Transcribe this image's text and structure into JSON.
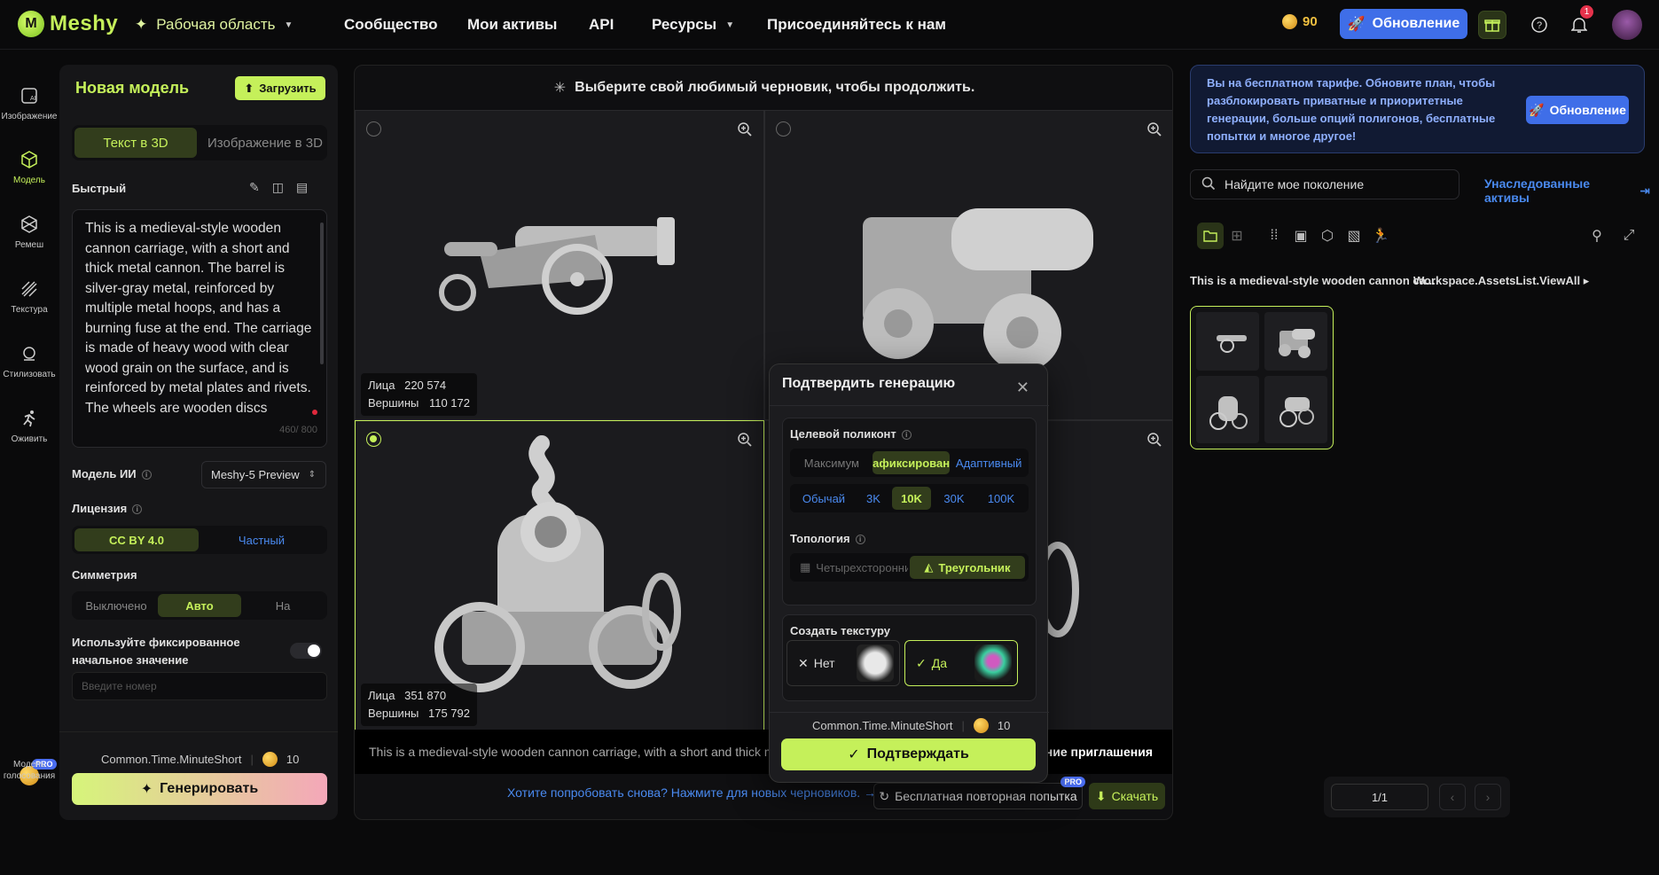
{
  "app": {
    "logo_text": "Meshy",
    "accent": "#c5f05a"
  },
  "nav": {
    "workspace": "Рабочая область",
    "community": "Сообщество",
    "assets": "Мои активы",
    "api": "API",
    "resources": "Ресурсы",
    "join": "Присоединяйтесь к нам",
    "credits": "90",
    "upgrade": "Обновление",
    "notifications_count": "1"
  },
  "rail": {
    "image": "Изображение",
    "model": "Модель",
    "remesh": "Ремеш",
    "texture": "Текстура",
    "stylize": "Стилизовать",
    "animate": "Оживить",
    "vote": "Модель голосования",
    "pro": "PRO"
  },
  "panel": {
    "title": "Новая модель",
    "upload": "Загрузить",
    "tab_text": "Текст в 3D",
    "tab_image": "Изображение в 3D",
    "mode": "Быстрый",
    "prompt": "This is a medieval-style wooden cannon carriage, with a short and thick metal cannon. The barrel is silver-gray metal, reinforced by multiple metal hoops, and has a burning fuse at the end. The carriage is made of heavy wood with clear wood grain on the surface, and is reinforced by metal plates and rivets. The wheels are wooden discs",
    "counter": "460/ 800",
    "ai_model_label": "Модель ИИ",
    "ai_model_value": "Meshy-5 Preview",
    "license_label": "Лицензия",
    "license_cc": "CC BY 4.0",
    "license_private": "Частный",
    "symmetry_label": "Симметрия",
    "sym_off": "Выключено",
    "sym_auto": "Авто",
    "sym_on": "На",
    "seed_label": "Используйте фиксированное начальное значение",
    "seed_placeholder": "Введите номер",
    "time": "Common.Time.MinuteShort",
    "cost": "10",
    "generate": "Генерировать"
  },
  "main": {
    "header": "Выберите свой любимый черновик, чтобы продолжить.",
    "faces_label": "Лица",
    "verts_label": "Вершины",
    "cells": [
      {
        "faces": "220 574",
        "verts": "110 172"
      },
      {
        "faces": "",
        "verts": ""
      },
      {
        "faces": "351 870",
        "verts": "175 792"
      },
      {
        "faces": "",
        "verts": ""
      }
    ],
    "prompt_strip": "This is a medieval-style wooden cannon carriage, with a short and thick m",
    "invite": "ние приглашения",
    "retry_link": "Хотите попробовать снова? Нажмите для новых черновиков. →",
    "free_retry": "Бесплатная повторная попытка",
    "pro": "PRO",
    "download": "Скачать"
  },
  "modal": {
    "title": "Подтвердить генерацию",
    "target_poly": "Целевой поликонт",
    "poly_opts": [
      "Максимум",
      "Зафиксировано",
      "Адаптивный"
    ],
    "count_opts": [
      "Обычай",
      "3K",
      "10K",
      "30K",
      "100K"
    ],
    "topology": "Топология",
    "topo_opts": [
      "Четырехсторонний",
      "Треугольник"
    ],
    "texture": "Создать текстуру",
    "no": "Нет",
    "yes": "Да",
    "time": "Common.Time.MinuteShort",
    "cost": "10",
    "confirm": "Подтверждать"
  },
  "right": {
    "promo": "Вы на бесплатном тарифе. Обновите план, чтобы разблокировать приватные и приоритетные генерации, больше опций полигонов, бесплатные попытки и многое другое!",
    "promo_btn": "Обновление",
    "search_placeholder": "Найдите мое поколение",
    "legacy": "Унаследованные активы",
    "asset_title": "This is a medieval-style wooden cannon ca...",
    "view_all": "Workspace.AssetsList.ViewAll",
    "page": "1/1"
  }
}
